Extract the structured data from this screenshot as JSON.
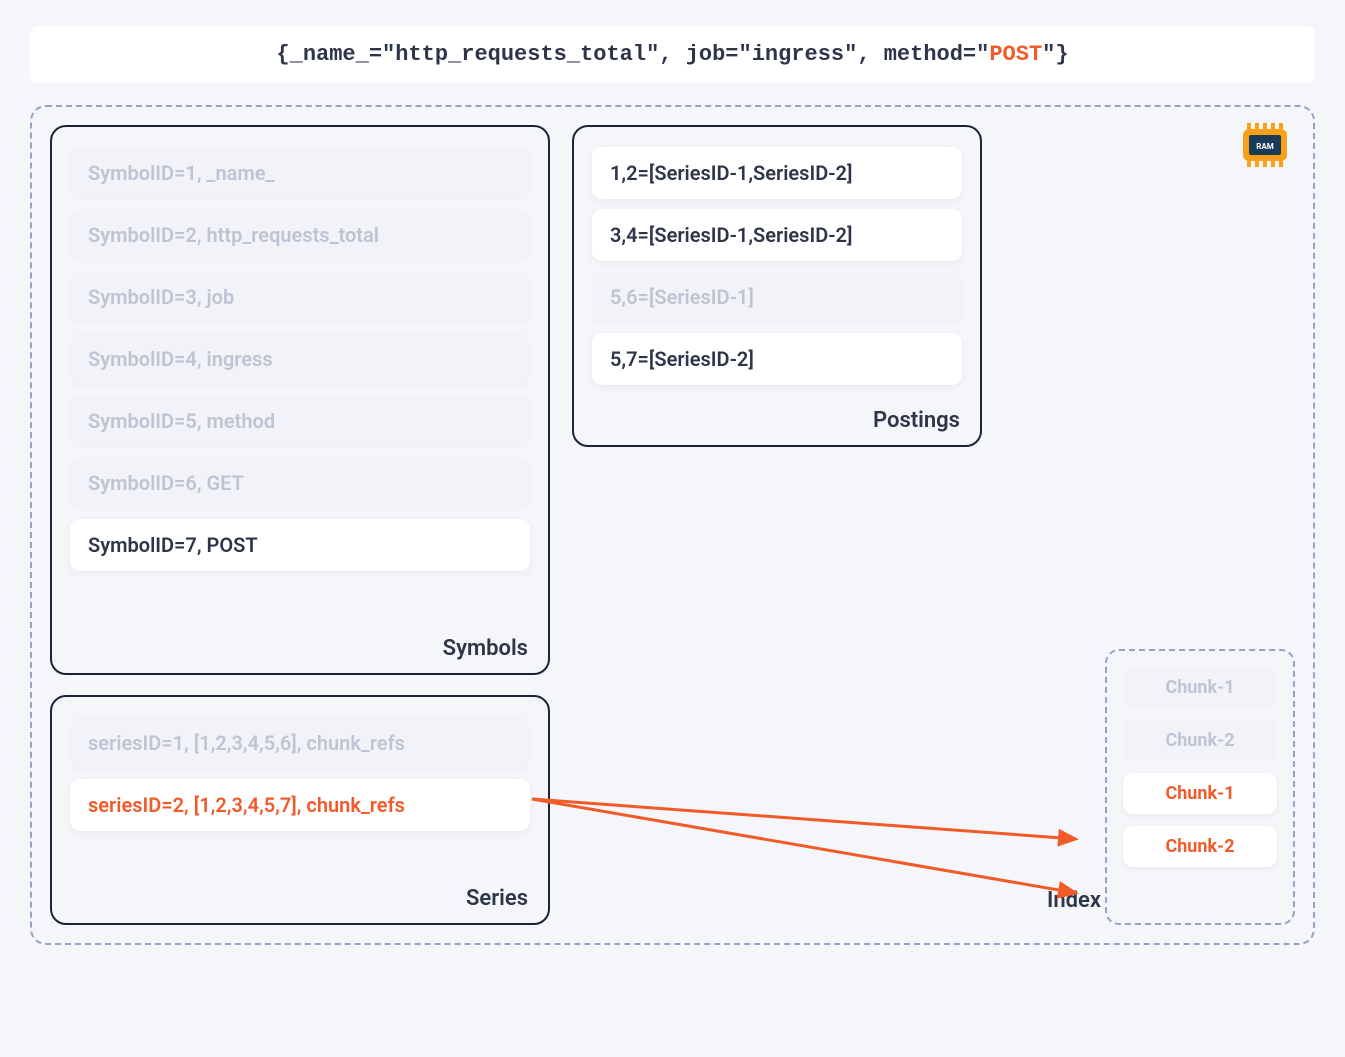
{
  "query": {
    "prefix": "{_name_=\"http_requests_total\", job=\"ingress\", method=\"",
    "highlight": "POST",
    "suffix": "\"}"
  },
  "symbols": {
    "label": "Symbols",
    "rows": [
      {
        "text": "SymbolID=1, _name_",
        "active": false
      },
      {
        "text": "SymbolID=2, http_requests_total",
        "active": false
      },
      {
        "text": "SymbolID=3, job",
        "active": false
      },
      {
        "text": "SymbolID=4, ingress",
        "active": false
      },
      {
        "text": "SymbolID=5, method",
        "active": false
      },
      {
        "text": "SymbolID=6, GET",
        "active": false
      },
      {
        "text": "SymbolID=7, POST",
        "active": true
      }
    ]
  },
  "postings": {
    "label": "Postings",
    "rows": [
      {
        "text": "1,2=[SeriesID-1,SeriesID-2]",
        "active": true
      },
      {
        "text": "3,4=[SeriesID-1,SeriesID-2]",
        "active": true
      },
      {
        "text": "5,6=[SeriesID-1]",
        "active": false
      },
      {
        "text": "5,7=[SeriesID-2]",
        "active": true
      }
    ]
  },
  "series": {
    "label": "Series",
    "rows": [
      {
        "text": "seriesID=1, [1,2,3,4,5,6], chunk_refs",
        "style": "dim"
      },
      {
        "text": "seriesID=2, [1,2,3,4,5,7], chunk_refs",
        "style": "orange"
      }
    ]
  },
  "index": {
    "label": "Index",
    "chunks": [
      {
        "text": "Chunk-1",
        "active": false
      },
      {
        "text": "Chunk-2",
        "active": false
      },
      {
        "text": "Chunk-1",
        "active": true
      },
      {
        "text": "Chunk-2",
        "active": true
      }
    ]
  },
  "ram_label": "RAM"
}
